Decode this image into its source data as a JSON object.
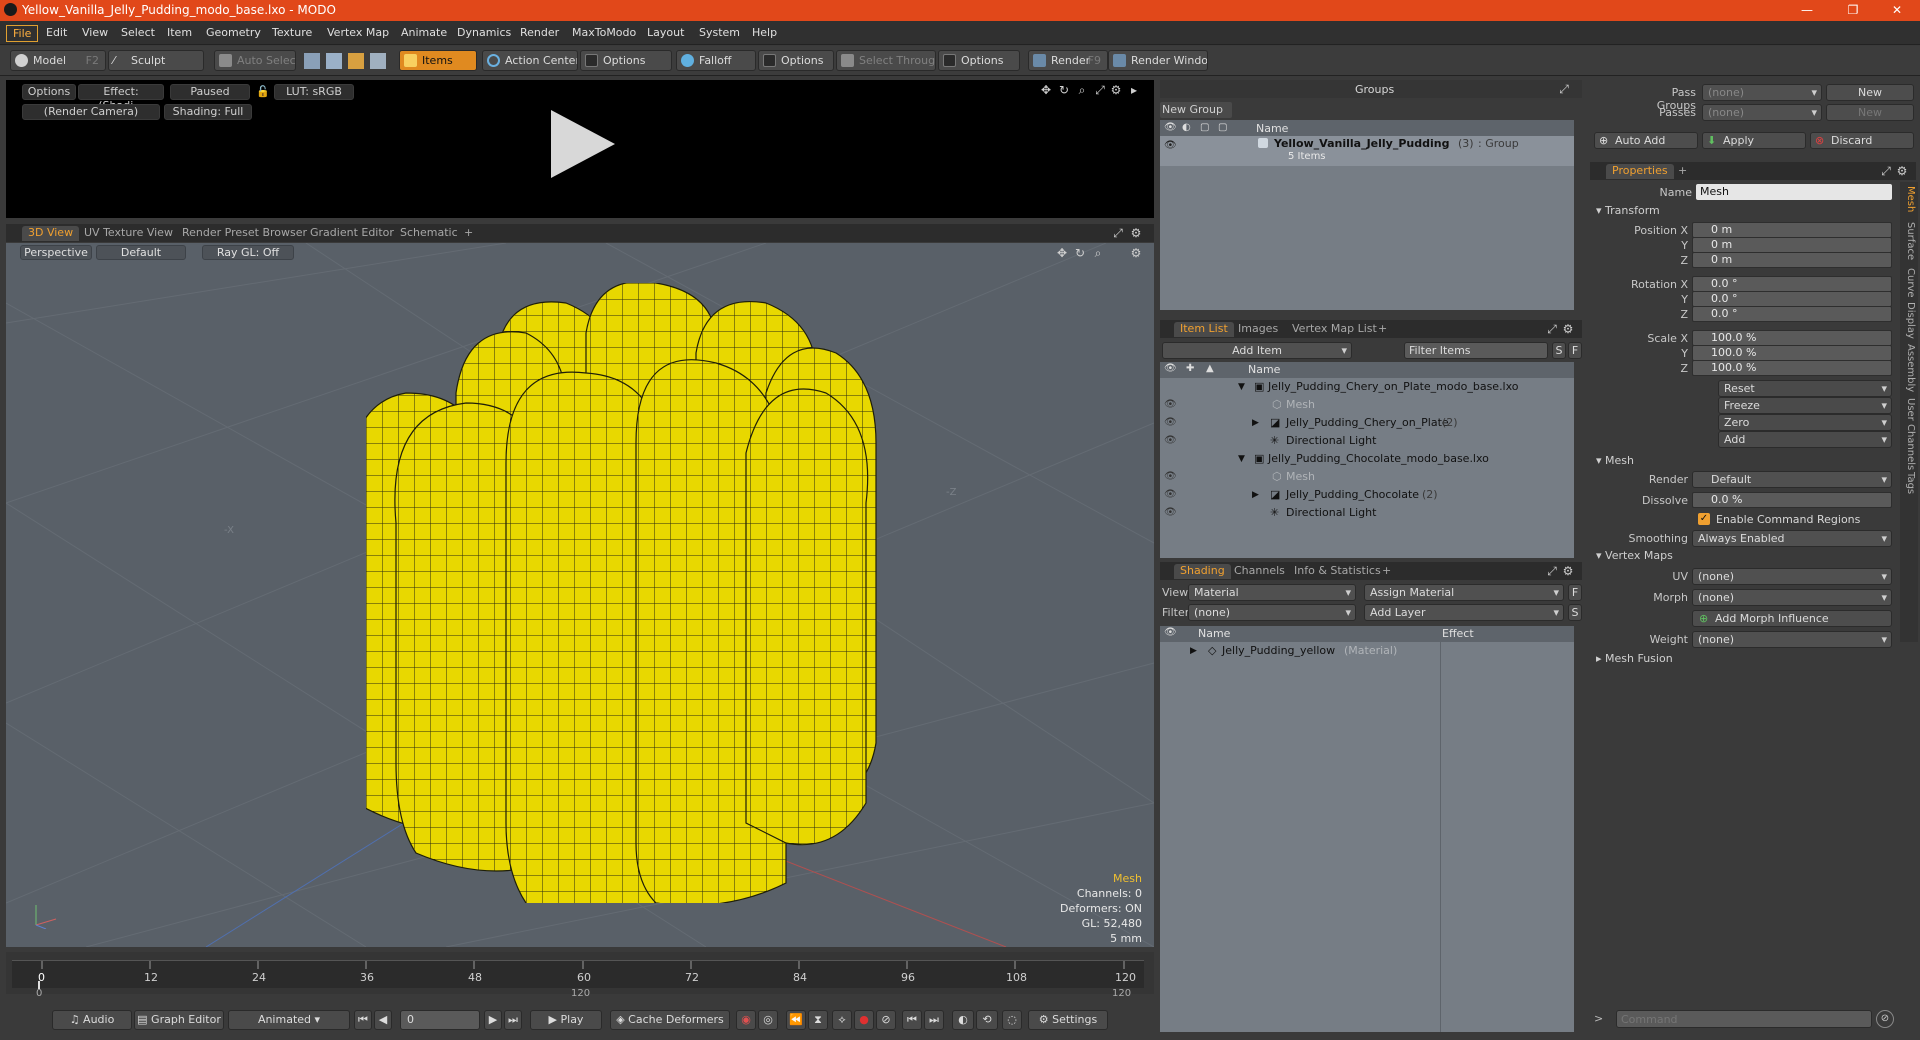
{
  "window": {
    "title": "Yellow_Vanilla_Jelly_Pudding_modo_base.lxo - MODO"
  },
  "menus": [
    "File",
    "Edit",
    "View",
    "Select",
    "Item",
    "Geometry",
    "Texture",
    "Vertex Map",
    "Animate",
    "Dynamics",
    "Render",
    "MaxToModo",
    "Layout",
    "System",
    "Help"
  ],
  "toolbar": {
    "model": "Model",
    "model_key": "F2",
    "sculpt": "Sculpt",
    "auto_select": "Auto Select",
    "items": "Items",
    "action_center": "Action Center",
    "options1": "Options",
    "falloff": "Falloff",
    "options2": "Options",
    "select_through": "Select Through",
    "options3": "Options",
    "render": "Render",
    "render_key": "F9",
    "render_window": "Render Window"
  },
  "render_preview": {
    "options": "Options",
    "effect": "Effect: (Shadi...",
    "paused": "Paused",
    "lut": "LUT: sRGB",
    "camera": "(Render Camera)",
    "shading": "Shading: Full"
  },
  "viewport_tabs": [
    "3D View",
    "UV Texture View",
    "Render Preset Browser",
    "Gradient Editor",
    "Schematic",
    "+"
  ],
  "viewport": {
    "perspective": "Perspective",
    "default": "Default",
    "raygl": "Ray GL: Off",
    "axis_x": "-X",
    "axis_z": "-Z",
    "info": {
      "type": "Mesh",
      "channels": "Channels: 0",
      "deformers": "Deformers: ON",
      "gl": "GL: 52,480",
      "scale": "5 mm"
    }
  },
  "timeline": {
    "ticks": [
      "0",
      "12",
      "24",
      "36",
      "48",
      "60",
      "72",
      "84",
      "96",
      "108",
      "120"
    ],
    "sub_start": "0",
    "sub_mid": "120",
    "sub_end": "120"
  },
  "bottombar": {
    "audio": "Audio",
    "graph_editor": "Graph Editor",
    "animated": "Animated",
    "frame": "0",
    "play": "Play",
    "cache_deformers": "Cache Deformers",
    "settings": "Settings"
  },
  "groups": {
    "title": "Groups",
    "new_group": "New Group",
    "col_name": "Name",
    "item_name": "Yellow_Vanilla_Jelly_Pudding",
    "item_count": "(3)",
    "item_type": ": Group",
    "item_sub": "5 Items"
  },
  "item_list": {
    "tabs": [
      "Item List",
      "Images",
      "Vertex Map List",
      "+"
    ],
    "add_item": "Add Item",
    "filter": "Filter Items",
    "s": "S",
    "f": "F",
    "col_name": "Name",
    "rows": [
      {
        "label": "Jelly_Pudding_Chery_on_Plate_modo_base.lxo",
        "arrow": "▼",
        "dim": false
      },
      {
        "label": "Mesh",
        "arrow": "",
        "dim": true
      },
      {
        "label": "Jelly_Pudding_Chery_on_Plate",
        "count": "(2)",
        "arrow": "▶",
        "dim": false
      },
      {
        "label": "Directional Light",
        "arrow": "",
        "dim": false
      },
      {
        "label": "Jelly_Pudding_Chocolate_modo_base.lxo",
        "arrow": "▼",
        "dim": false
      },
      {
        "label": "Mesh",
        "arrow": "",
        "dim": true
      },
      {
        "label": "Jelly_Pudding_Chocolate",
        "count": "(2)",
        "arrow": "▶",
        "dim": false
      },
      {
        "label": "Directional Light",
        "arrow": "",
        "dim": false
      }
    ]
  },
  "shading": {
    "tabs": [
      "Shading",
      "Channels",
      "Info & Statistics",
      "+"
    ],
    "view_label": "View",
    "view_value": "Material",
    "assign_material": "Assign Material",
    "f": "F",
    "filter_label": "Filter",
    "filter_value": "(none)",
    "add_layer": "Add Layer",
    "s": "S",
    "col_name": "Name",
    "col_effect": "Effect",
    "row_name": "Jelly_Pudding_yellow",
    "row_type": "(Material)"
  },
  "pass": {
    "pass_groups": "Pass Groups",
    "pass_groups_value": "(none)",
    "new": "New",
    "passes": "Passes",
    "passes_value": "(none)",
    "new2": "New",
    "auto_add": "Auto Add",
    "apply": "Apply",
    "discard": "Discard"
  },
  "properties": {
    "tab": "Properties",
    "plus": "+",
    "name_label": "Name",
    "name_value": "Mesh",
    "transform": "Transform",
    "position_x_label": "Position X",
    "y_label": "Y",
    "z_label": "Z",
    "pos_x": "0 m",
    "pos_y": "0 m",
    "pos_z": "0 m",
    "rotation_x_label": "Rotation X",
    "rot_x": "0.0 °",
    "rot_y": "0.0 °",
    "rot_z": "0.0 °",
    "scale_x_label": "Scale X",
    "scl_x": "100.0 %",
    "scl_y": "100.0 %",
    "scl_z": "100.0 %",
    "reset": "Reset",
    "freeze": "Freeze",
    "zero": "Zero",
    "add": "Add",
    "mesh": "Mesh",
    "render_label": "Render",
    "render_value": "Default",
    "dissolve_label": "Dissolve",
    "dissolve_value": "0.0 %",
    "enable_cmd": "Enable Command Regions",
    "smoothing_label": "Smoothing",
    "smoothing_value": "Always Enabled",
    "vertex_maps": "Vertex Maps",
    "uv_label": "UV",
    "uv_value": "(none)",
    "morph_label": "Morph",
    "morph_value": "(none)",
    "add_morph": "Add Morph Influence",
    "weight_label": "Weight",
    "weight_value": "(none)",
    "mesh_fusion": "Mesh Fusion",
    "side_tabs": [
      "Mesh",
      "Surface",
      "Curve",
      "Display",
      "Assembly",
      "User Channels",
      "Tags"
    ]
  },
  "command": {
    "placeholder": "Command"
  },
  "colors": {
    "accent": "#f0a030",
    "titlebar": "#e1481a",
    "mesh": "#e8d800"
  }
}
